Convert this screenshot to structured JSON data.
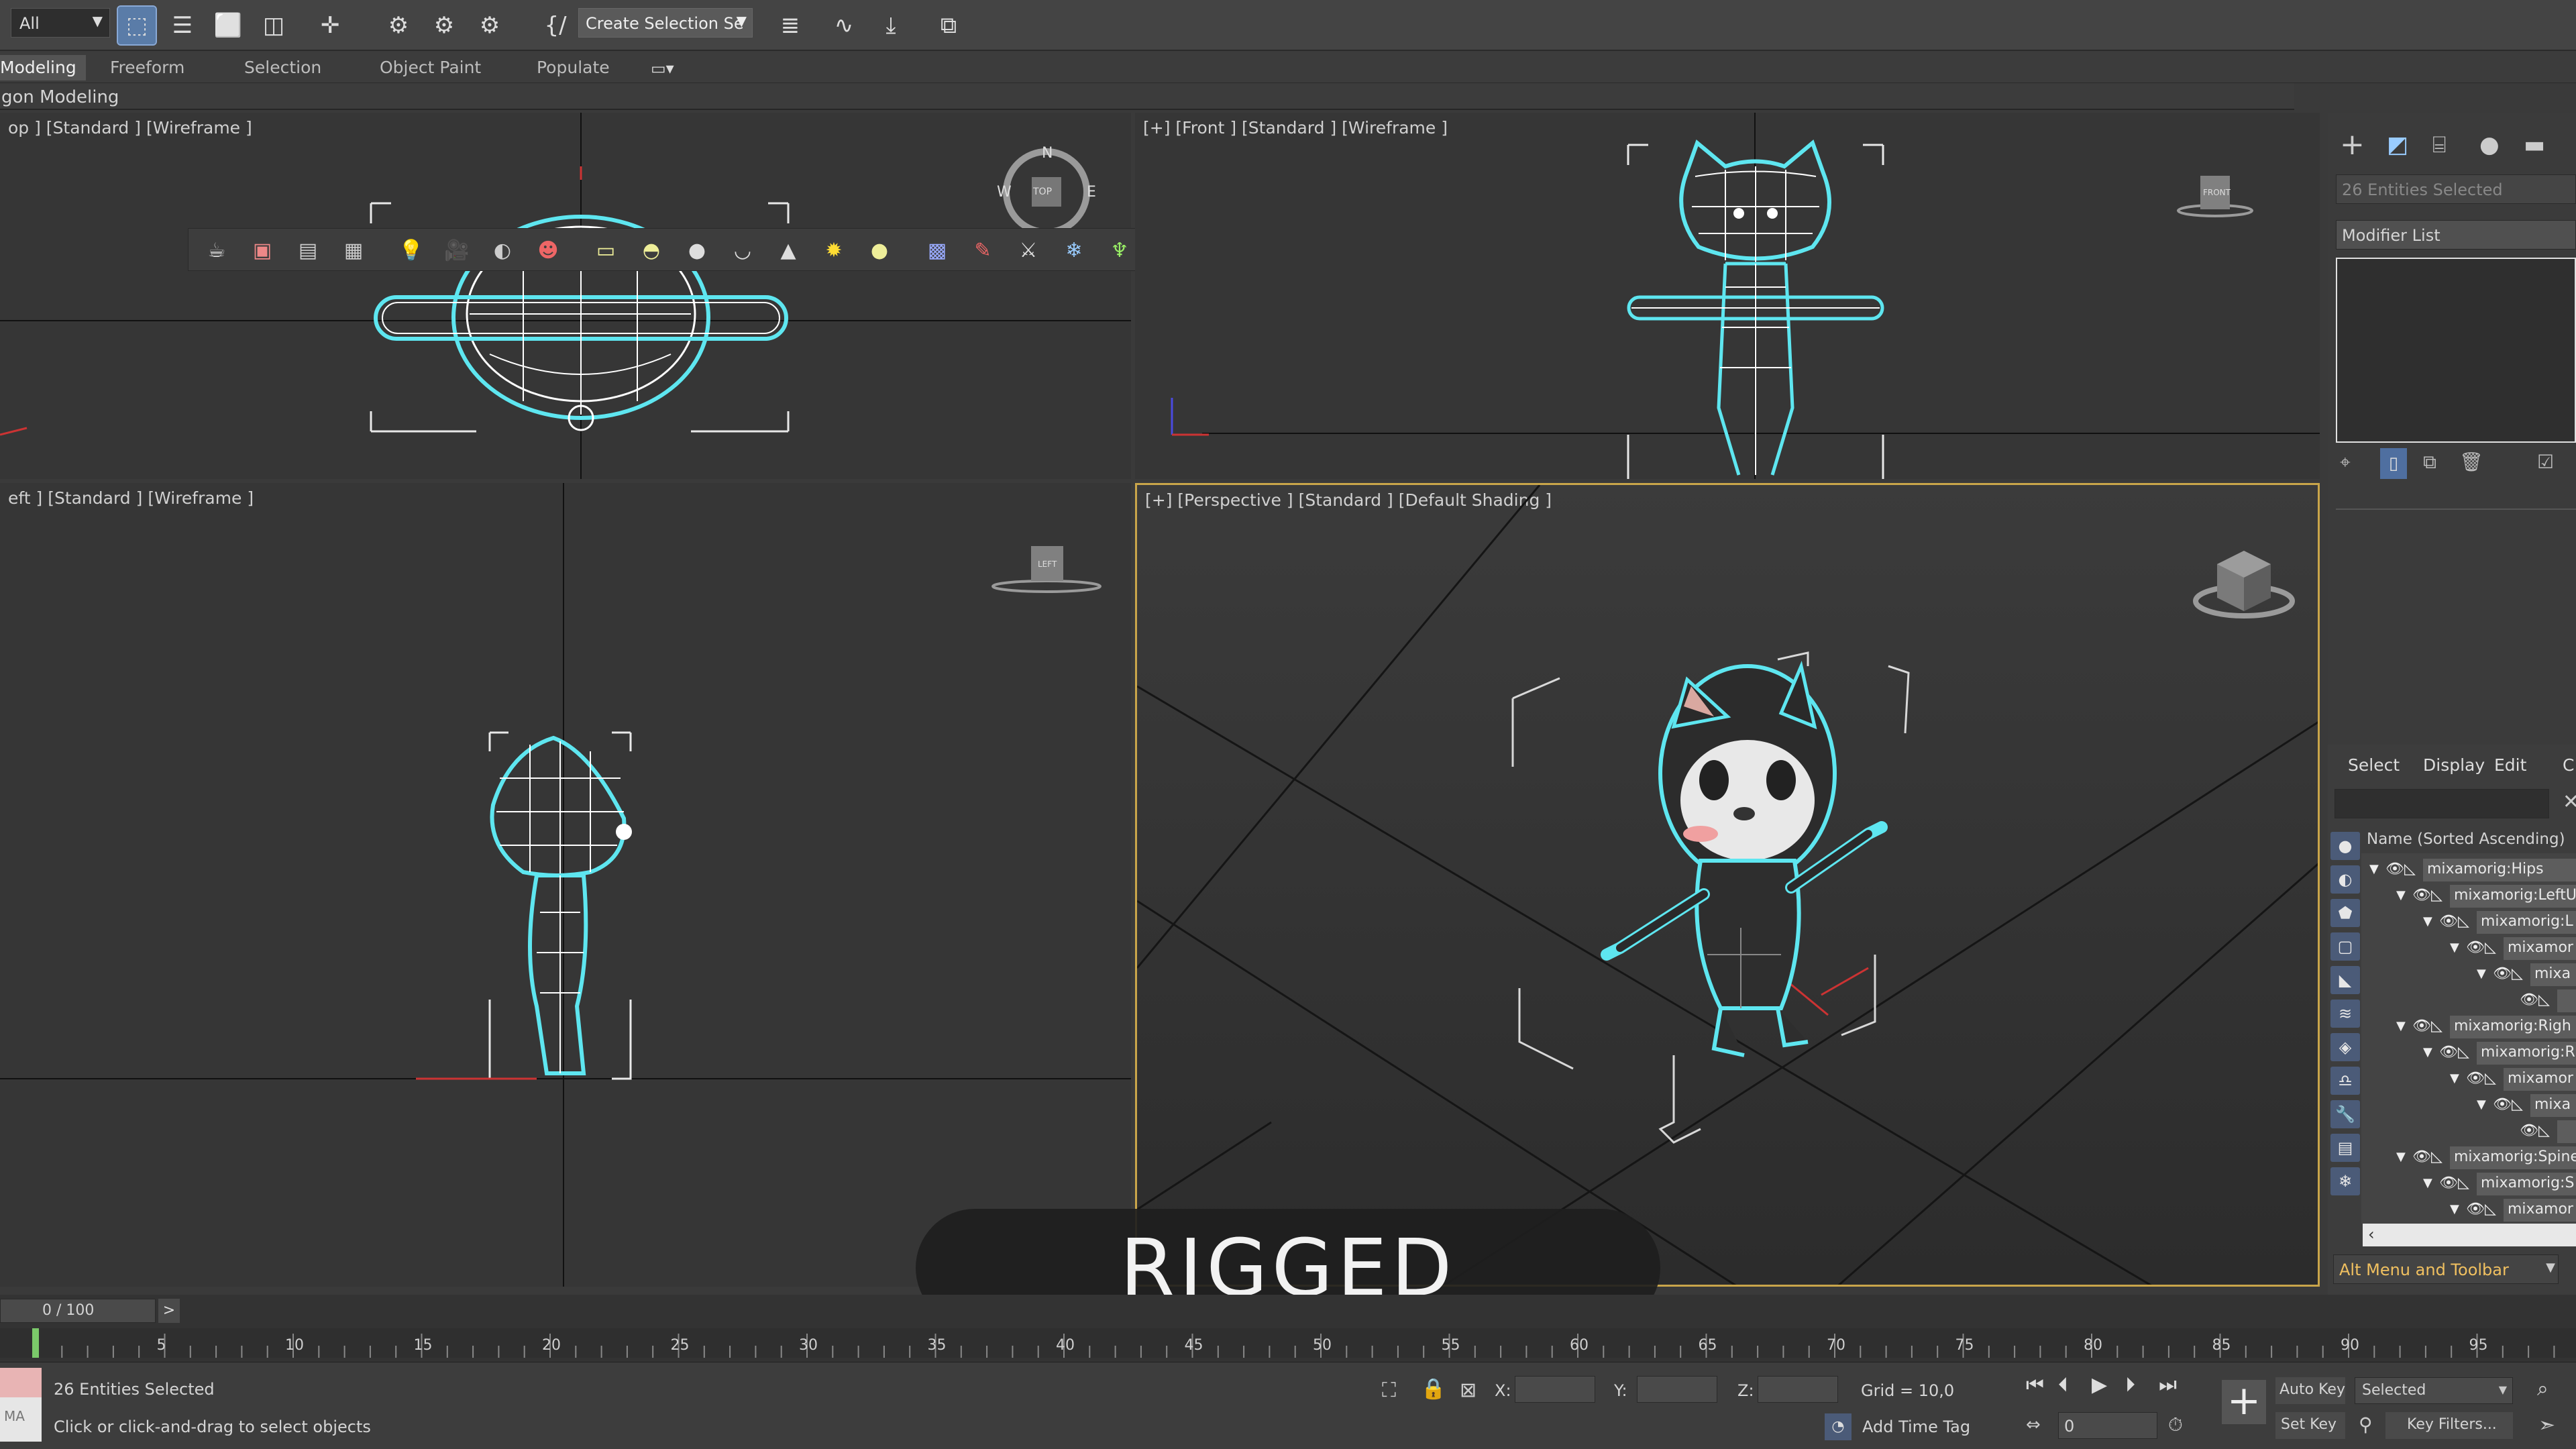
{
  "toolbar": {
    "filter_value": "All",
    "selection_set_placeholder": "Create Selection Se",
    "icons": [
      "select-object-icon",
      "select-by-name-icon",
      "rect-selection-region-icon",
      "window-crossing-icon",
      "select-move-icon",
      "link-icon",
      "unlink-icon",
      "bind-space-warp-icon",
      "named-selection-braces-icon",
      "layer-explorer-icon",
      "curve-editor-icon",
      "schematic-view-icon",
      "material-editor-icon"
    ]
  },
  "ribbon": {
    "tabs": [
      "Modeling",
      "Freeform",
      "Selection",
      "Object Paint",
      "Populate"
    ],
    "subtitle": "gon Modeling"
  },
  "viewports": {
    "top": {
      "label": "op ] [Standard ] [Wireframe ]",
      "viewcube": "TOP",
      "compass": {
        "n": "N",
        "w": "W",
        "e": "E"
      }
    },
    "front": {
      "label": "[+] [Front ] [Standard ] [Wireframe ]",
      "viewcube": "FRONT"
    },
    "left": {
      "label": "eft ] [Standard ] [Wireframe ]",
      "viewcube": "LEFT"
    },
    "perspective": {
      "label": "[+] [Perspective ] [Standard ] [Default Shading ]"
    }
  },
  "caption": "RIGGED",
  "command_panel": {
    "selection_info": "26 Entities Selected",
    "modifier_list_label": "Modifier List"
  },
  "scene_explorer": {
    "tabs": [
      "Select",
      "Display",
      "Edit",
      "C"
    ],
    "column_header": "Name (Sorted Ascending)",
    "rows": [
      {
        "label": "mixamorig:Hips",
        "indent": 0
      },
      {
        "label": "mixamorig:LeftU",
        "indent": 1
      },
      {
        "label": "mixamorig:L",
        "indent": 2
      },
      {
        "label": "mixamor",
        "indent": 3
      },
      {
        "label": "mixa",
        "indent": 4
      },
      {
        "label": "",
        "indent": 5
      },
      {
        "label": "mixamorig:Righ",
        "indent": 1
      },
      {
        "label": "mixamorig:R",
        "indent": 2
      },
      {
        "label": "mixamor",
        "indent": 3
      },
      {
        "label": "mixa",
        "indent": 4
      },
      {
        "label": "",
        "indent": 5
      },
      {
        "label": "mixamorig:Spine",
        "indent": 1
      },
      {
        "label": "mixamorig:S",
        "indent": 2
      },
      {
        "label": "mixamor",
        "indent": 3
      }
    ],
    "workspace": "Alt Menu and Toolbar"
  },
  "timeline": {
    "frame_counter": "0 / 100",
    "ticks": [
      "5",
      "10",
      "15",
      "20",
      "25",
      "30",
      "35",
      "40",
      "45",
      "50",
      "55",
      "60",
      "65",
      "70",
      "75",
      "80",
      "85",
      "90",
      "95"
    ]
  },
  "status_bar": {
    "maxscript_label": "MA",
    "selection_status": "26 Entities Selected",
    "prompt": "Click or click-and-drag to select objects",
    "x_label": "X:",
    "y_label": "Y:",
    "z_label": "Z:",
    "grid": "Grid = 10,0",
    "add_time_tag": "Add Time Tag",
    "auto_key": "Auto Key",
    "set_key": "Set Key",
    "key_mode": "Selected",
    "key_filters": "Key Filters...",
    "frame_value": "0"
  },
  "colors": {
    "selection_cyan": "#5ee6f0",
    "active_viewport_border": "#c9a54a",
    "accent_blue": "#5a7ca8"
  }
}
